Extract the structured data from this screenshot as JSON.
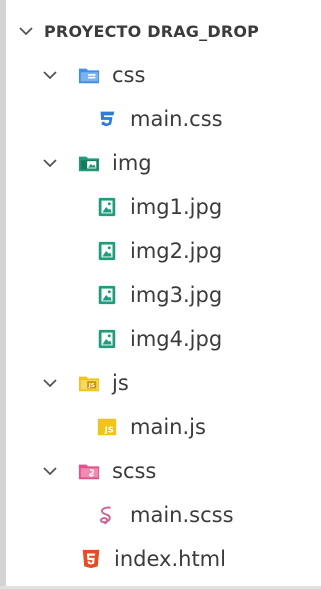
{
  "explorer": {
    "project_title": "PROYECTO DRAG_DROP",
    "folders": {
      "css": {
        "label": "css",
        "files": [
          {
            "label": "main.css",
            "icon": "css-file-icon"
          }
        ]
      },
      "img": {
        "label": "img",
        "files": [
          {
            "label": "img1.jpg",
            "icon": "image-file-icon"
          },
          {
            "label": "img2.jpg",
            "icon": "image-file-icon"
          },
          {
            "label": "img3.jpg",
            "icon": "image-file-icon"
          },
          {
            "label": "img4.jpg",
            "icon": "image-file-icon"
          }
        ]
      },
      "js": {
        "label": "js",
        "files": [
          {
            "label": "main.js",
            "icon": "js-file-icon"
          }
        ]
      },
      "scss": {
        "label": "scss",
        "files": [
          {
            "label": "main.scss",
            "icon": "sass-file-icon"
          }
        ]
      }
    },
    "root_files": [
      {
        "label": "index.html",
        "icon": "html-file-icon"
      }
    ]
  },
  "colors": {
    "css_folder": "#3f8ee8",
    "img_folder": "#1e9c7b",
    "js_folder": "#f0c419",
    "scss_folder": "#e0528c",
    "css_file": "#2b7bd8",
    "image_file": "#1e9c7b",
    "js_file": "#f0c419",
    "sass_file": "#cd6799",
    "html_file": "#e34c26"
  }
}
